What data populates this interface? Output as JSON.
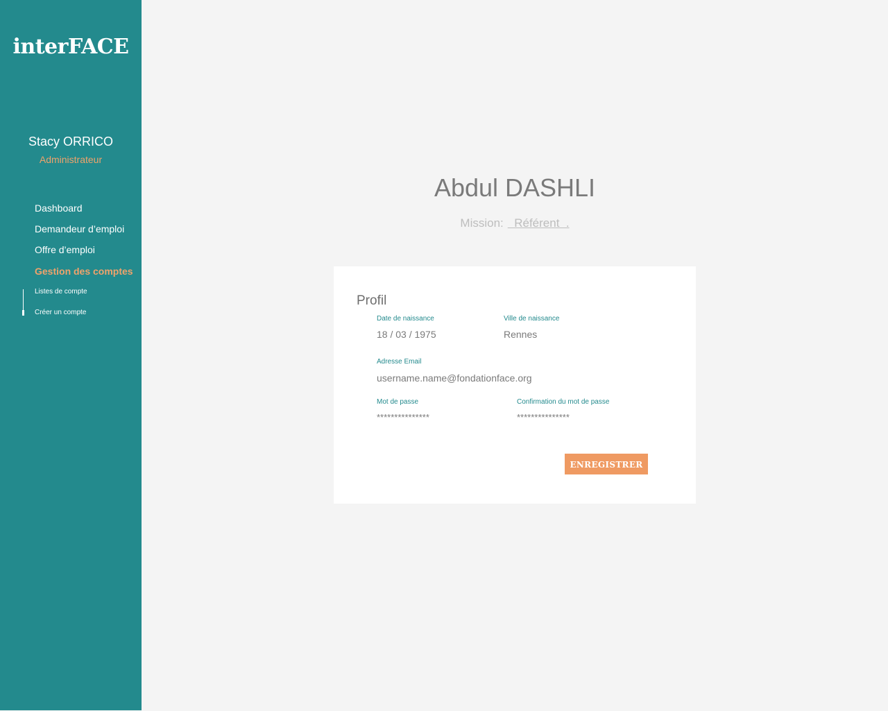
{
  "sidebar": {
    "logo": "interFACE",
    "user": {
      "name": "Stacy ORRICO",
      "role": "Administrateur"
    },
    "nav": [
      {
        "label": "Dashboard"
      },
      {
        "label": "Demandeur d’emploi"
      },
      {
        "label": "Offre d’emploi"
      },
      {
        "label": "Gestion des comptes"
      }
    ],
    "subnav": [
      {
        "label": "Listes de compte"
      },
      {
        "label": "Créer un compte"
      }
    ]
  },
  "main": {
    "name": "Abdul DASHLI",
    "mission_label": "Mission:",
    "mission_value": "  Référent  .",
    "card": {
      "title": "Profil",
      "fields": {
        "birth_date": {
          "label": "Date de naissance",
          "value": "18 / 03 / 1975"
        },
        "birth_city": {
          "label": "Ville de naissance",
          "value": "Rennes"
        },
        "email": {
          "label": "Adresse Email",
          "value": "username.name@fondationface.org"
        },
        "password": {
          "label": "Mot de passe",
          "value": "***************"
        },
        "password_confirm": {
          "label": "Confirmation du mot de passe",
          "value": "***************"
        }
      },
      "save_label": "ENREGISTRER"
    }
  },
  "colors": {
    "sidebar_bg": "#238a8d",
    "accent": "#f0a36b",
    "button": "#ef9a62",
    "page_bg": "#f4f4f4"
  }
}
